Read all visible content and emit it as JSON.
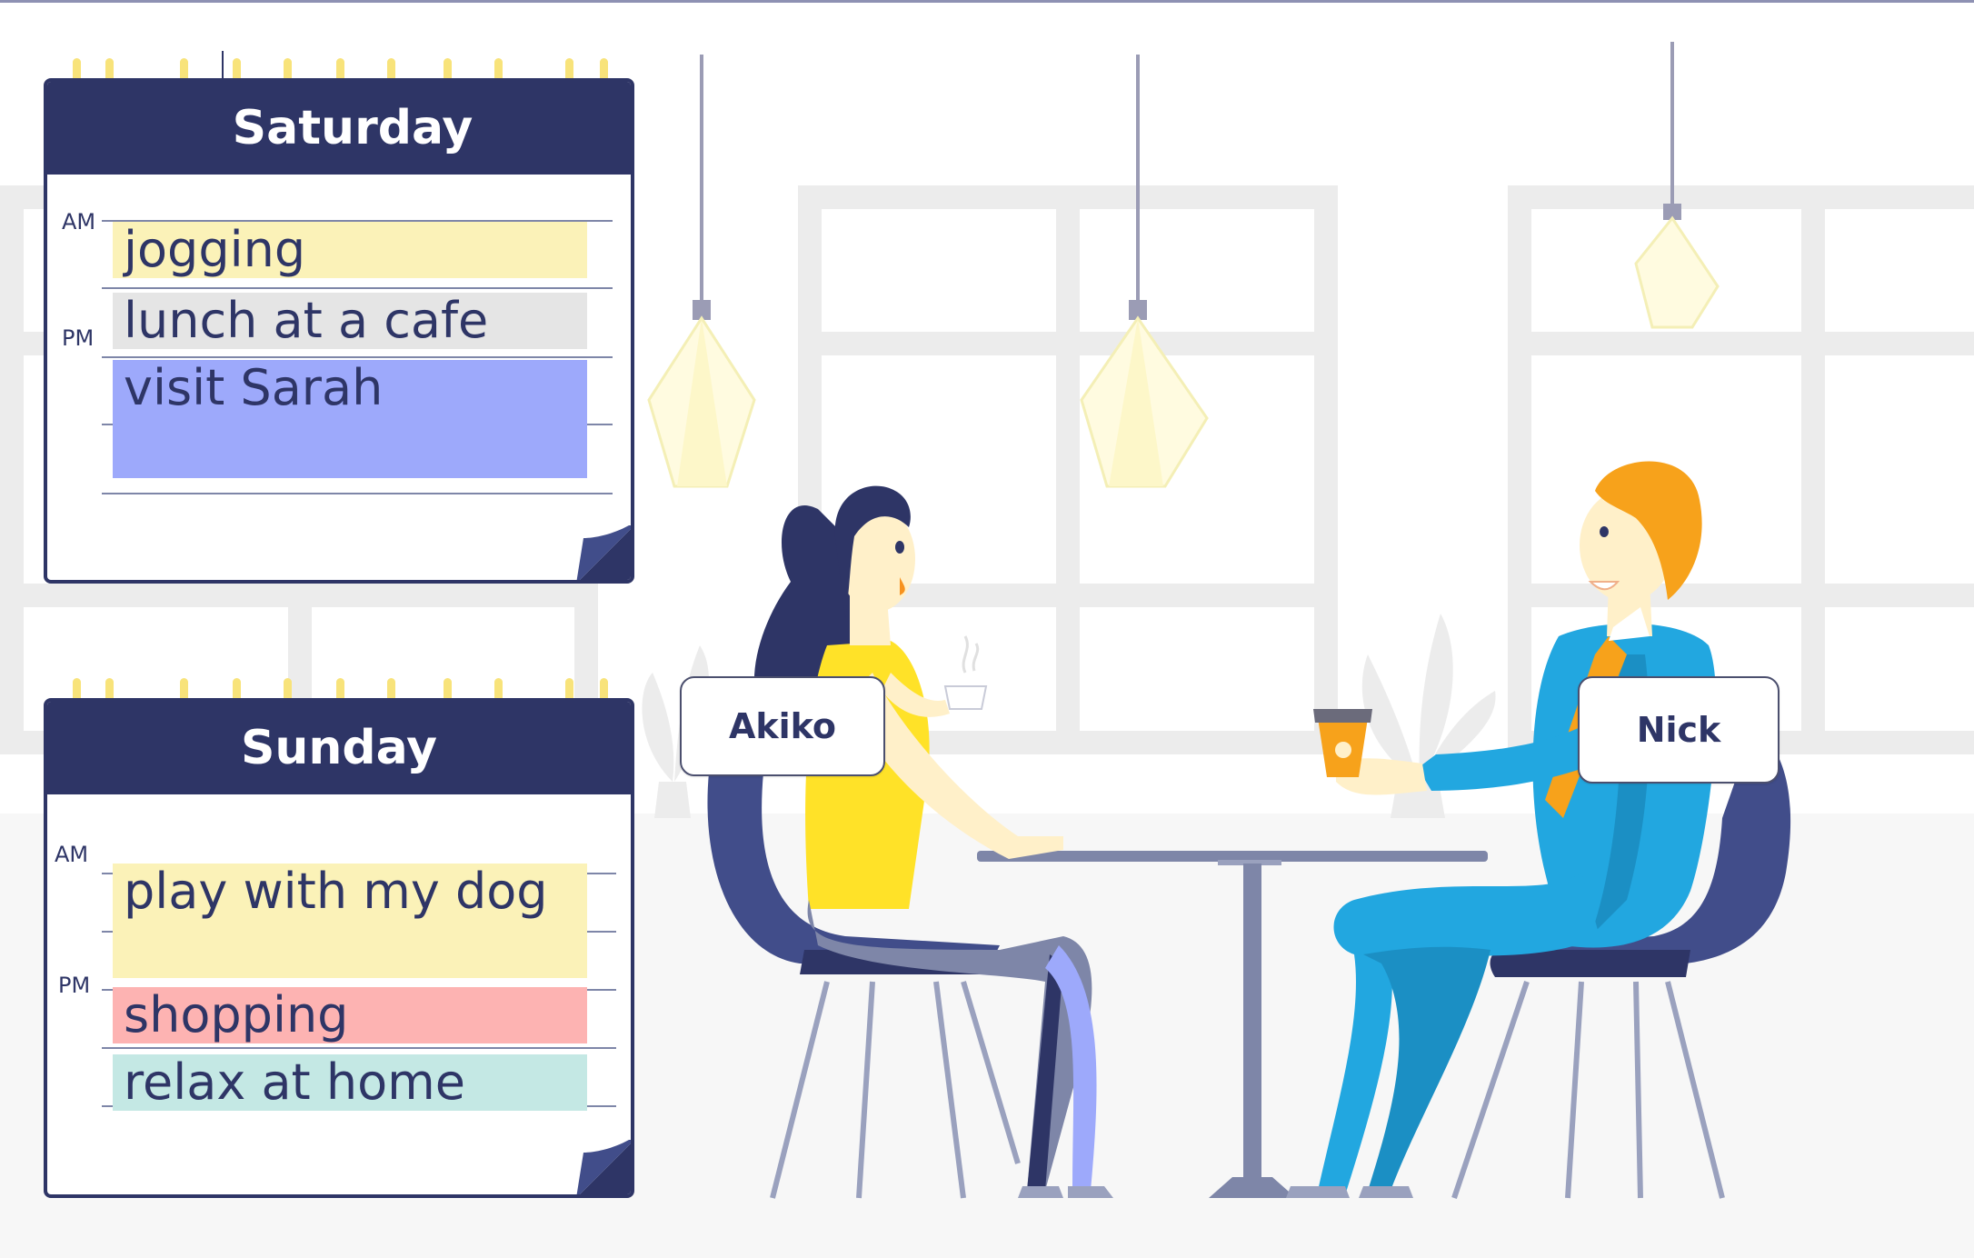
{
  "calendars": {
    "saturday": {
      "day": "Saturday",
      "am_label": "AM",
      "pm_label": "PM",
      "entries": [
        {
          "text": "jogging",
          "color": "#fbf2b8"
        },
        {
          "text": "lunch at a cafe",
          "color": "#e5e5e5"
        },
        {
          "text": "visit Sarah",
          "color": "#9da9fb"
        }
      ]
    },
    "sunday": {
      "day": "Sunday",
      "am_label": "AM",
      "pm_label": "PM",
      "entries": [
        {
          "text": "play with my dog",
          "color": "#fbf2b8"
        },
        {
          "text": "shopping",
          "color": "#fdb3b2"
        },
        {
          "text": "relax at home",
          "color": "#c4e8e4"
        }
      ]
    }
  },
  "people": {
    "left_name": "Akiko",
    "right_name": "Nick"
  },
  "colors": {
    "navy": "#2e3566",
    "ring_yellow": "#f8e37a",
    "floor": "#f7f7f7",
    "window_frame": "#ececec"
  }
}
